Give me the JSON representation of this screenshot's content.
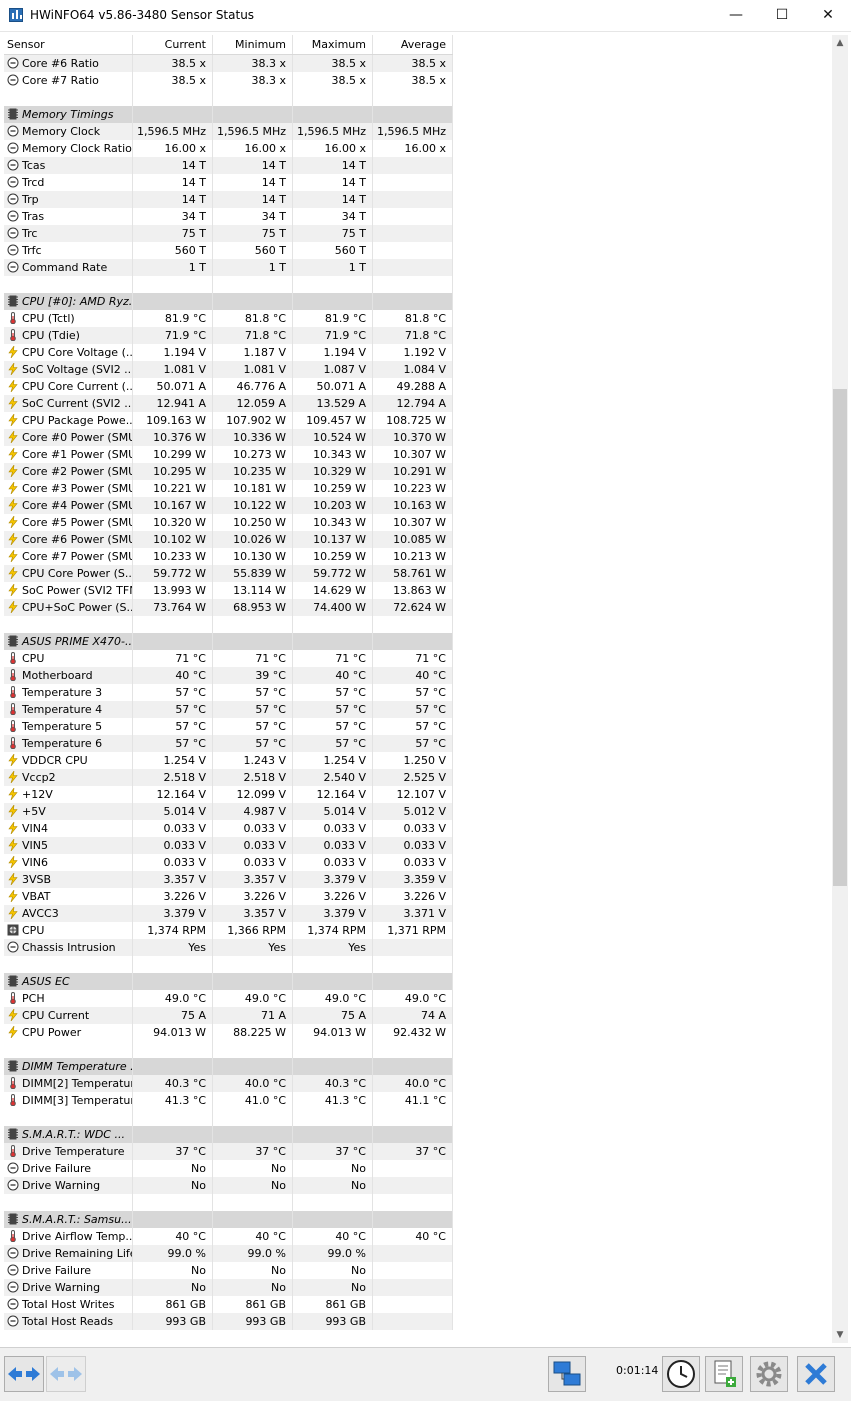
{
  "window": {
    "title": "HWiNFO64 v5.86-3480 Sensor Status",
    "minimize": "—",
    "maximize": "☐",
    "close": "✕"
  },
  "columns": [
    "Sensor",
    "Current",
    "Minimum",
    "Maximum",
    "Average"
  ],
  "rows": [
    {
      "t": "v",
      "icon": "clock",
      "name": "Core #6 Ratio",
      "cur": "38.5 x",
      "min": "38.3 x",
      "max": "38.5 x",
      "avg": "38.5 x"
    },
    {
      "t": "v",
      "icon": "clock",
      "name": "Core #7 Ratio",
      "cur": "38.5 x",
      "min": "38.3 x",
      "max": "38.5 x",
      "avg": "38.5 x"
    },
    {
      "t": "b"
    },
    {
      "t": "g",
      "name": "Memory Timings"
    },
    {
      "t": "v",
      "icon": "clock",
      "name": "Memory Clock",
      "cur": "1,596.5 MHz",
      "min": "1,596.5 MHz",
      "max": "1,596.5 MHz",
      "avg": "1,596.5 MHz"
    },
    {
      "t": "v",
      "icon": "clock",
      "name": "Memory Clock Ratio",
      "cur": "16.00 x",
      "min": "16.00 x",
      "max": "16.00 x",
      "avg": "16.00 x"
    },
    {
      "t": "v",
      "icon": "clock",
      "name": "Tcas",
      "cur": "14 T",
      "min": "14 T",
      "max": "14 T",
      "avg": ""
    },
    {
      "t": "v",
      "icon": "clock",
      "name": "Trcd",
      "cur": "14 T",
      "min": "14 T",
      "max": "14 T",
      "avg": ""
    },
    {
      "t": "v",
      "icon": "clock",
      "name": "Trp",
      "cur": "14 T",
      "min": "14 T",
      "max": "14 T",
      "avg": ""
    },
    {
      "t": "v",
      "icon": "clock",
      "name": "Tras",
      "cur": "34 T",
      "min": "34 T",
      "max": "34 T",
      "avg": ""
    },
    {
      "t": "v",
      "icon": "clock",
      "name": "Trc",
      "cur": "75 T",
      "min": "75 T",
      "max": "75 T",
      "avg": ""
    },
    {
      "t": "v",
      "icon": "clock",
      "name": "Trfc",
      "cur": "560 T",
      "min": "560 T",
      "max": "560 T",
      "avg": ""
    },
    {
      "t": "v",
      "icon": "clock",
      "name": "Command Rate",
      "cur": "1 T",
      "min": "1 T",
      "max": "1 T",
      "avg": ""
    },
    {
      "t": "b"
    },
    {
      "t": "g",
      "name": "CPU [#0]: AMD Ryz..."
    },
    {
      "t": "v",
      "icon": "therm",
      "name": "CPU (Tctl)",
      "cur": "81.9 °C",
      "min": "81.8 °C",
      "max": "81.9 °C",
      "avg": "81.8 °C"
    },
    {
      "t": "v",
      "icon": "therm",
      "name": "CPU (Tdie)",
      "cur": "71.9 °C",
      "min": "71.8 °C",
      "max": "71.9 °C",
      "avg": "71.8 °C"
    },
    {
      "t": "v",
      "icon": "bolt",
      "name": "CPU Core Voltage (...",
      "cur": "1.194 V",
      "min": "1.187 V",
      "max": "1.194 V",
      "avg": "1.192 V"
    },
    {
      "t": "v",
      "icon": "bolt",
      "name": "SoC Voltage (SVI2 ...",
      "cur": "1.081 V",
      "min": "1.081 V",
      "max": "1.087 V",
      "avg": "1.084 V"
    },
    {
      "t": "v",
      "icon": "bolt",
      "name": "CPU Core Current (...",
      "cur": "50.071 A",
      "min": "46.776 A",
      "max": "50.071 A",
      "avg": "49.288 A"
    },
    {
      "t": "v",
      "icon": "bolt",
      "name": "SoC Current (SVI2 ...",
      "cur": "12.941 A",
      "min": "12.059 A",
      "max": "13.529 A",
      "avg": "12.794 A"
    },
    {
      "t": "v",
      "icon": "bolt",
      "name": "CPU Package Powe...",
      "cur": "109.163 W",
      "min": "107.902 W",
      "max": "109.457 W",
      "avg": "108.725 W"
    },
    {
      "t": "v",
      "icon": "bolt",
      "name": "Core #0 Power (SMU)",
      "cur": "10.376 W",
      "min": "10.336 W",
      "max": "10.524 W",
      "avg": "10.370 W"
    },
    {
      "t": "v",
      "icon": "bolt",
      "name": "Core #1 Power (SMU)",
      "cur": "10.299 W",
      "min": "10.273 W",
      "max": "10.343 W",
      "avg": "10.307 W"
    },
    {
      "t": "v",
      "icon": "bolt",
      "name": "Core #2 Power (SMU)",
      "cur": "10.295 W",
      "min": "10.235 W",
      "max": "10.329 W",
      "avg": "10.291 W"
    },
    {
      "t": "v",
      "icon": "bolt",
      "name": "Core #3 Power (SMU)",
      "cur": "10.221 W",
      "min": "10.181 W",
      "max": "10.259 W",
      "avg": "10.223 W"
    },
    {
      "t": "v",
      "icon": "bolt",
      "name": "Core #4 Power (SMU)",
      "cur": "10.167 W",
      "min": "10.122 W",
      "max": "10.203 W",
      "avg": "10.163 W"
    },
    {
      "t": "v",
      "icon": "bolt",
      "name": "Core #5 Power (SMU)",
      "cur": "10.320 W",
      "min": "10.250 W",
      "max": "10.343 W",
      "avg": "10.307 W"
    },
    {
      "t": "v",
      "icon": "bolt",
      "name": "Core #6 Power (SMU)",
      "cur": "10.102 W",
      "min": "10.026 W",
      "max": "10.137 W",
      "avg": "10.085 W"
    },
    {
      "t": "v",
      "icon": "bolt",
      "name": "Core #7 Power (SMU)",
      "cur": "10.233 W",
      "min": "10.130 W",
      "max": "10.259 W",
      "avg": "10.213 W"
    },
    {
      "t": "v",
      "icon": "bolt",
      "name": "CPU Core Power (S...",
      "cur": "59.772 W",
      "min": "55.839 W",
      "max": "59.772 W",
      "avg": "58.761 W"
    },
    {
      "t": "v",
      "icon": "bolt",
      "name": "SoC Power (SVI2 TFN)",
      "cur": "13.993 W",
      "min": "13.114 W",
      "max": "14.629 W",
      "avg": "13.863 W"
    },
    {
      "t": "v",
      "icon": "bolt",
      "name": "CPU+SoC Power (S...",
      "cur": "73.764 W",
      "min": "68.953 W",
      "max": "74.400 W",
      "avg": "72.624 W"
    },
    {
      "t": "b"
    },
    {
      "t": "g",
      "name": "ASUS PRIME X470-..."
    },
    {
      "t": "v",
      "icon": "therm",
      "name": "CPU",
      "cur": "71 °C",
      "min": "71 °C",
      "max": "71 °C",
      "avg": "71 °C"
    },
    {
      "t": "v",
      "icon": "therm",
      "name": "Motherboard",
      "cur": "40 °C",
      "min": "39 °C",
      "max": "40 °C",
      "avg": "40 °C"
    },
    {
      "t": "v",
      "icon": "therm",
      "name": "Temperature 3",
      "cur": "57 °C",
      "min": "57 °C",
      "max": "57 °C",
      "avg": "57 °C"
    },
    {
      "t": "v",
      "icon": "therm",
      "name": "Temperature 4",
      "cur": "57 °C",
      "min": "57 °C",
      "max": "57 °C",
      "avg": "57 °C"
    },
    {
      "t": "v",
      "icon": "therm",
      "name": "Temperature 5",
      "cur": "57 °C",
      "min": "57 °C",
      "max": "57 °C",
      "avg": "57 °C"
    },
    {
      "t": "v",
      "icon": "therm",
      "name": "Temperature 6",
      "cur": "57 °C",
      "min": "57 °C",
      "max": "57 °C",
      "avg": "57 °C"
    },
    {
      "t": "v",
      "icon": "bolt",
      "name": "VDDCR CPU",
      "cur": "1.254 V",
      "min": "1.243 V",
      "max": "1.254 V",
      "avg": "1.250 V"
    },
    {
      "t": "v",
      "icon": "bolt",
      "name": "Vccp2",
      "cur": "2.518 V",
      "min": "2.518 V",
      "max": "2.540 V",
      "avg": "2.525 V"
    },
    {
      "t": "v",
      "icon": "bolt",
      "name": "+12V",
      "cur": "12.164 V",
      "min": "12.099 V",
      "max": "12.164 V",
      "avg": "12.107 V"
    },
    {
      "t": "v",
      "icon": "bolt",
      "name": "+5V",
      "cur": "5.014 V",
      "min": "4.987 V",
      "max": "5.014 V",
      "avg": "5.012 V"
    },
    {
      "t": "v",
      "icon": "bolt",
      "name": "VIN4",
      "cur": "0.033 V",
      "min": "0.033 V",
      "max": "0.033 V",
      "avg": "0.033 V"
    },
    {
      "t": "v",
      "icon": "bolt",
      "name": "VIN5",
      "cur": "0.033 V",
      "min": "0.033 V",
      "max": "0.033 V",
      "avg": "0.033 V"
    },
    {
      "t": "v",
      "icon": "bolt",
      "name": "VIN6",
      "cur": "0.033 V",
      "min": "0.033 V",
      "max": "0.033 V",
      "avg": "0.033 V"
    },
    {
      "t": "v",
      "icon": "bolt",
      "name": "3VSB",
      "cur": "3.357 V",
      "min": "3.357 V",
      "max": "3.379 V",
      "avg": "3.359 V"
    },
    {
      "t": "v",
      "icon": "bolt",
      "name": "VBAT",
      "cur": "3.226 V",
      "min": "3.226 V",
      "max": "3.226 V",
      "avg": "3.226 V"
    },
    {
      "t": "v",
      "icon": "bolt",
      "name": "AVCC3",
      "cur": "3.379 V",
      "min": "3.357 V",
      "max": "3.379 V",
      "avg": "3.371 V"
    },
    {
      "t": "v",
      "icon": "fan",
      "name": "CPU",
      "cur": "1,374 RPM",
      "min": "1,366 RPM",
      "max": "1,374 RPM",
      "avg": "1,371 RPM"
    },
    {
      "t": "v",
      "icon": "clock",
      "name": "Chassis Intrusion",
      "cur": "Yes",
      "min": "Yes",
      "max": "Yes",
      "avg": ""
    },
    {
      "t": "b"
    },
    {
      "t": "g",
      "name": "ASUS EC"
    },
    {
      "t": "v",
      "icon": "therm",
      "name": "PCH",
      "cur": "49.0 °C",
      "min": "49.0 °C",
      "max": "49.0 °C",
      "avg": "49.0 °C"
    },
    {
      "t": "v",
      "icon": "bolt",
      "name": "CPU Current",
      "cur": "75 A",
      "min": "71 A",
      "max": "75 A",
      "avg": "74 A"
    },
    {
      "t": "v",
      "icon": "bolt",
      "name": "CPU Power",
      "cur": "94.013 W",
      "min": "88.225 W",
      "max": "94.013 W",
      "avg": "92.432 W"
    },
    {
      "t": "b"
    },
    {
      "t": "g",
      "name": "DIMM Temperature ..."
    },
    {
      "t": "v",
      "icon": "therm",
      "name": "DIMM[2] Temperature",
      "cur": "40.3 °C",
      "min": "40.0 °C",
      "max": "40.3 °C",
      "avg": "40.0 °C"
    },
    {
      "t": "v",
      "icon": "therm",
      "name": "DIMM[3] Temperature",
      "cur": "41.3 °C",
      "min": "41.0 °C",
      "max": "41.3 °C",
      "avg": "41.1 °C"
    },
    {
      "t": "b"
    },
    {
      "t": "g",
      "name": "S.M.A.R.T.: WDC ..."
    },
    {
      "t": "v",
      "icon": "therm",
      "name": "Drive Temperature",
      "cur": "37 °C",
      "min": "37 °C",
      "max": "37 °C",
      "avg": "37 °C"
    },
    {
      "t": "v",
      "icon": "clock",
      "name": "Drive Failure",
      "cur": "No",
      "min": "No",
      "max": "No",
      "avg": ""
    },
    {
      "t": "v",
      "icon": "clock",
      "name": "Drive Warning",
      "cur": "No",
      "min": "No",
      "max": "No",
      "avg": ""
    },
    {
      "t": "b"
    },
    {
      "t": "g",
      "name": "S.M.A.R.T.: Samsu..."
    },
    {
      "t": "v",
      "icon": "therm",
      "name": "Drive Airflow Temp...",
      "cur": "40 °C",
      "min": "40 °C",
      "max": "40 °C",
      "avg": "40 °C"
    },
    {
      "t": "v",
      "icon": "clock",
      "name": "Drive Remaining Life",
      "cur": "99.0 %",
      "min": "99.0 %",
      "max": "99.0 %",
      "avg": ""
    },
    {
      "t": "v",
      "icon": "clock",
      "name": "Drive Failure",
      "cur": "No",
      "min": "No",
      "max": "No",
      "avg": ""
    },
    {
      "t": "v",
      "icon": "clock",
      "name": "Drive Warning",
      "cur": "No",
      "min": "No",
      "max": "No",
      "avg": ""
    },
    {
      "t": "v",
      "icon": "clock",
      "name": "Total Host Writes",
      "cur": "861 GB",
      "min": "861 GB",
      "max": "861 GB",
      "avg": ""
    },
    {
      "t": "v",
      "icon": "clock",
      "name": "Total Host Reads",
      "cur": "993 GB",
      "min": "993 GB",
      "max": "993 GB",
      "avg": ""
    }
  ],
  "scrollbar": {
    "up": "▲",
    "down": "▼"
  },
  "statusbar": {
    "elapsed": "0:01:14"
  },
  "colors": {
    "group_bg": "#d7d7d7",
    "alt_row": "#f0f0f0",
    "accent": "#2e7bd6",
    "bolt": "#f5c400"
  }
}
